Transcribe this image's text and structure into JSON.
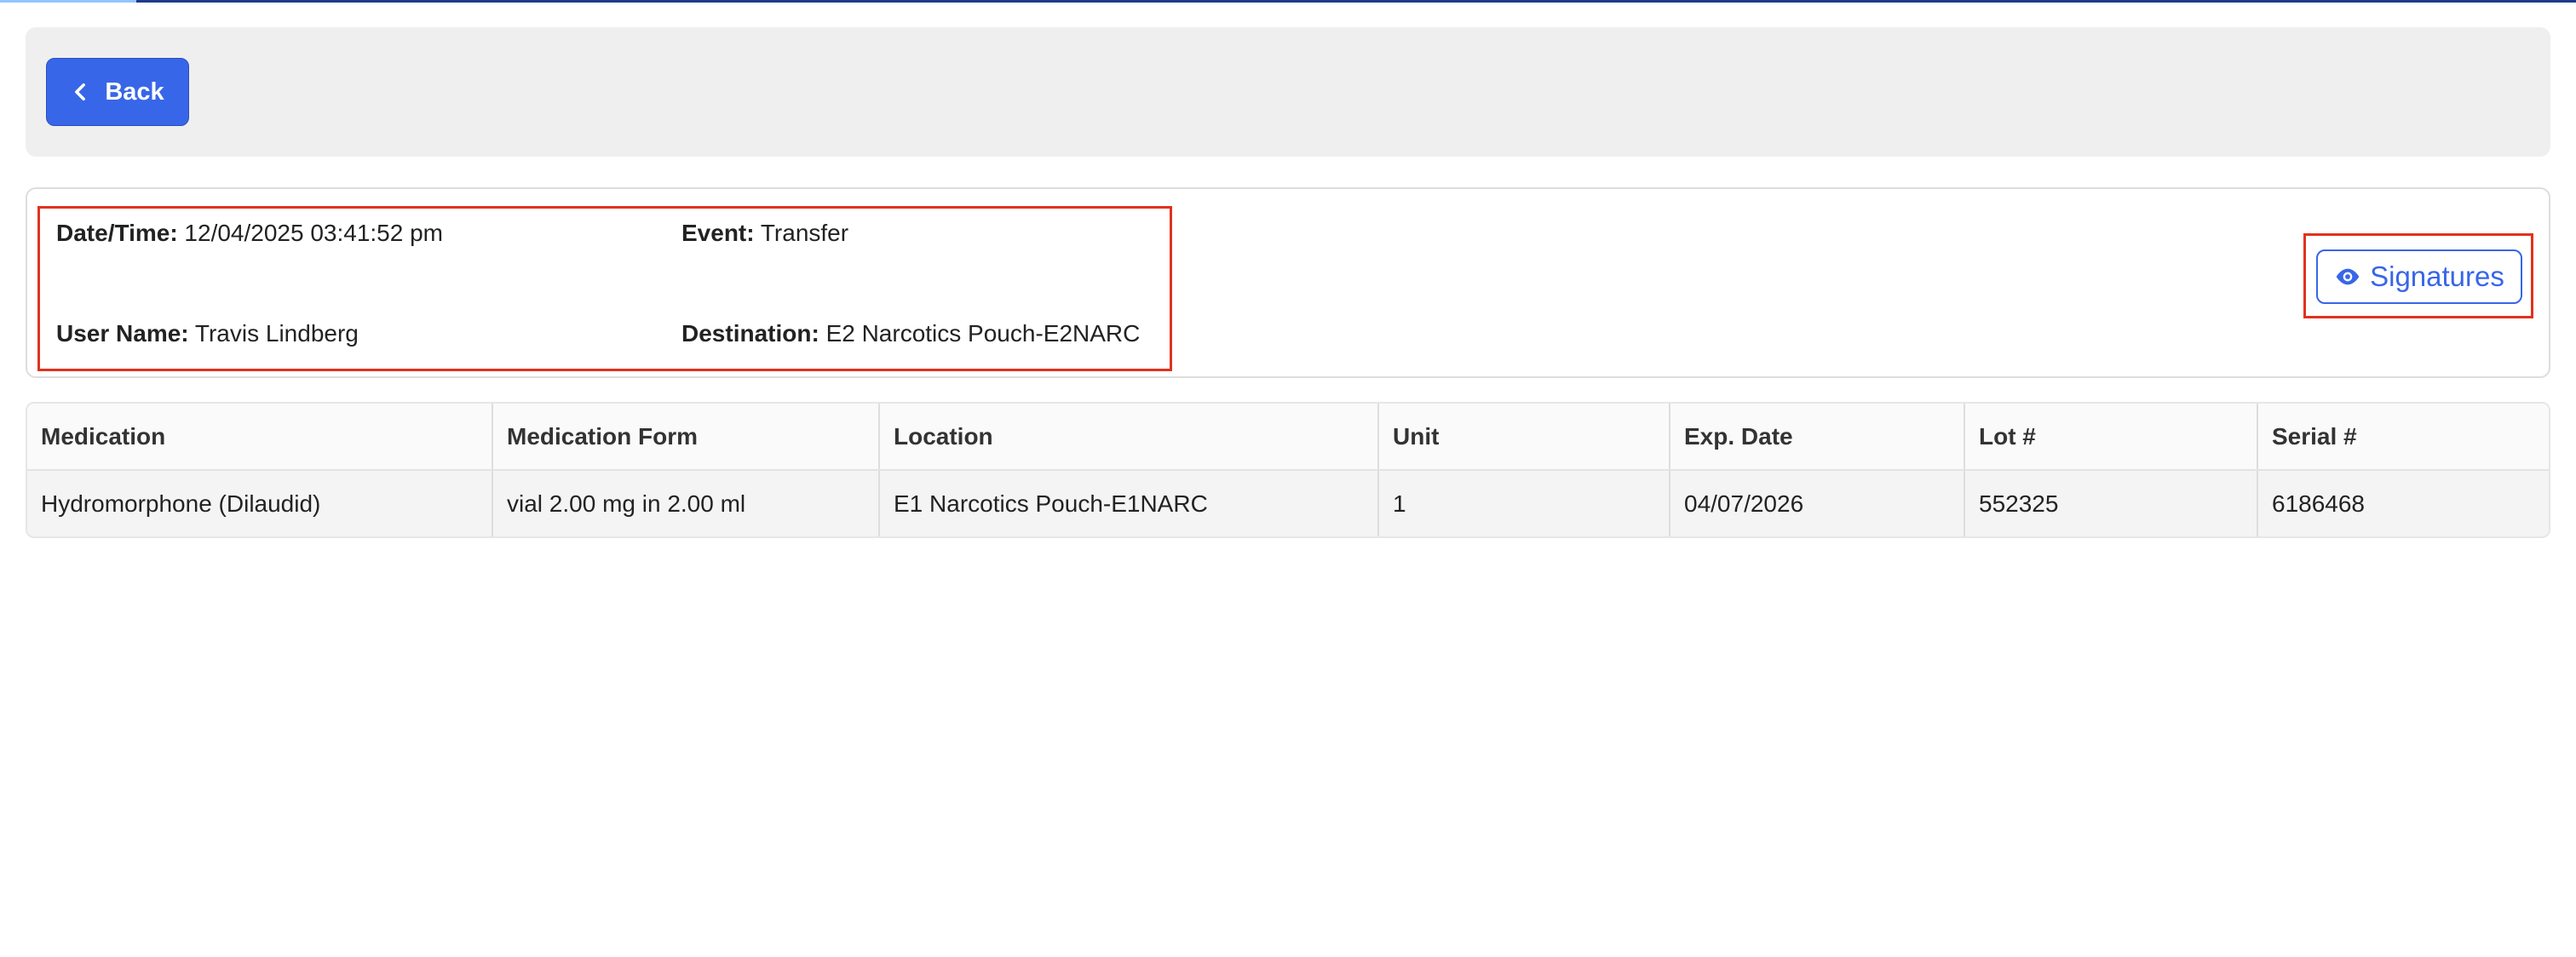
{
  "toolbar": {
    "back_label": "Back"
  },
  "details": {
    "datetime_label": "Date/Time:",
    "datetime_value": "12/04/2025 03:41:52 pm",
    "event_label": "Event:",
    "event_value": "Transfer",
    "username_label": "User Name:",
    "username_value": "Travis Lindberg",
    "destination_label": "Destination:",
    "destination_value": "E2 Narcotics Pouch-E2NARC"
  },
  "signatures": {
    "label": "Signatures",
    "icon": "eye-icon"
  },
  "table": {
    "headers": [
      "Medication",
      "Medication Form",
      "Location",
      "Unit",
      "Exp. Date",
      "Lot #",
      "Serial #"
    ],
    "rows": [
      [
        "Hydromorphone (Dilaudid)",
        "vial 2.00 mg in 2.00 ml",
        "E1 Narcotics Pouch-E1NARC",
        "1",
        "04/07/2026",
        "552325",
        "6186468"
      ]
    ]
  },
  "colors": {
    "primary": "#3866e8",
    "highlight": "#e0321e",
    "toolbar_bg": "#efefef"
  }
}
